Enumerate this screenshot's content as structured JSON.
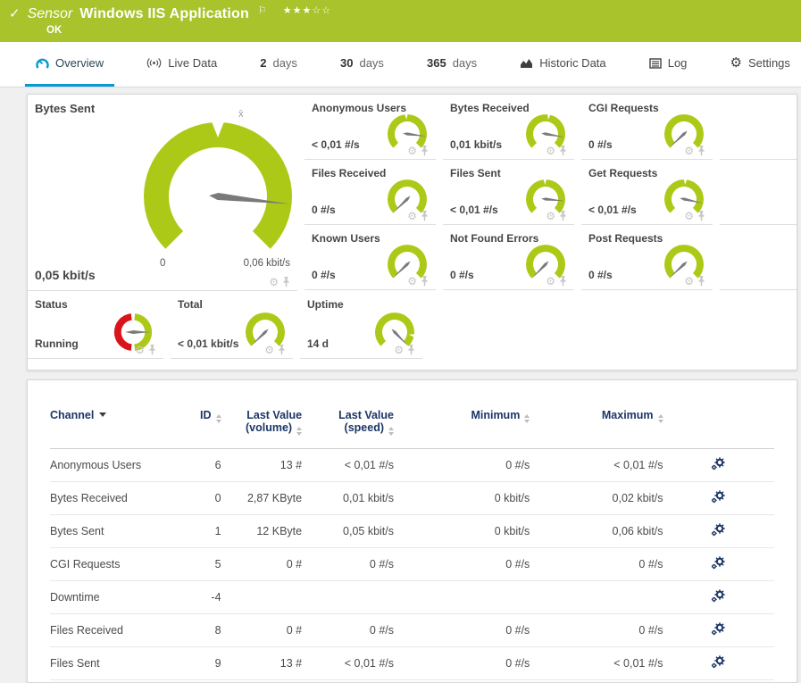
{
  "colors": {
    "header_green": "#a8c32b",
    "gauge_green": "#adc917",
    "status_red": "#d9151b",
    "blue": "#0898d4",
    "navy": "#1b3667",
    "needle_gray": "#7a7a7a"
  },
  "header": {
    "kind_label": "Sensor",
    "title": "Windows IIS Application",
    "status": "OK",
    "stars_filled": 3,
    "stars_total": 5,
    "check_icon": "✓",
    "flag_icon": "⚐"
  },
  "tabs": [
    {
      "id": "overview",
      "icon": "gauge-icon",
      "label": "Overview",
      "active": true
    },
    {
      "id": "live-data",
      "icon": "broadcast-icon",
      "label": "Live Data"
    },
    {
      "id": "2-days",
      "num": "2",
      "label": "days"
    },
    {
      "id": "30-days",
      "num": "30",
      "label": "days"
    },
    {
      "id": "365-days",
      "num": "365",
      "label": "days"
    },
    {
      "id": "historic-data",
      "icon": "chart-icon",
      "label": "Historic Data"
    },
    {
      "id": "log",
      "icon": "log-icon",
      "label": "Log"
    },
    {
      "id": "settings",
      "icon": "gear-icon",
      "label": "Settings"
    }
  ],
  "gauges": {
    "main": {
      "label": "Bytes Sent",
      "value": "0,05 kbit/s",
      "scale_min": "0",
      "scale_max": "0,06 kbit/s",
      "avg_marker": "x̄",
      "needle_deg": 96,
      "notch_deg": 0
    },
    "small": [
      {
        "label": "Anonymous Users",
        "value": "< 0,01 #/s",
        "needle_deg": 97,
        "notch_deg": -3
      },
      {
        "label": "Bytes Received",
        "value": "0,01 kbit/s",
        "needle_deg": 100,
        "notch_deg": 10
      },
      {
        "label": "CGI Requests",
        "value": "0 #/s",
        "needle_deg": 227,
        "notch_deg": null
      },
      {
        "label": "Files Received",
        "value": "0 #/s",
        "needle_deg": 226,
        "notch_deg": null
      },
      {
        "label": "Files Sent",
        "value": "< 0,01 #/s",
        "needle_deg": 96,
        "notch_deg": -2
      },
      {
        "label": "Get Requests",
        "value": "< 0,01 #/s",
        "needle_deg": 102,
        "notch_deg": 4
      },
      {
        "label": "Known Users",
        "value": "0 #/s",
        "needle_deg": 226,
        "notch_deg": null
      },
      {
        "label": "Not Found Errors",
        "value": "0 #/s",
        "needle_deg": 224,
        "notch_deg": null
      },
      {
        "label": "Post Requests",
        "value": "0 #/s",
        "needle_deg": 227,
        "notch_deg": null
      }
    ],
    "bottom": [
      {
        "label": "Status",
        "value": "Running",
        "kind": "ring",
        "needle_deg": 90
      },
      {
        "label": "Total",
        "value": "< 0,01 kbit/s",
        "needle_deg": 226,
        "notch_deg": null
      },
      {
        "label": "Uptime",
        "value": "14 d",
        "needle_deg": 136,
        "notch_deg": 100
      }
    ]
  },
  "table": {
    "headers": [
      {
        "label": "Channel",
        "sort": "down",
        "align": "left"
      },
      {
        "label": "ID",
        "sort": "both",
        "align": "right"
      },
      {
        "lines": [
          "Last Value",
          "(volume)"
        ],
        "sort": "both",
        "align": "right"
      },
      {
        "lines": [
          "Last Value",
          "(speed)"
        ],
        "sort": "both",
        "align": "right"
      },
      {
        "label": "Minimum",
        "sort": "both",
        "align": "right"
      },
      {
        "label": "Maximum",
        "sort": "both",
        "align": "right"
      },
      {
        "label": "",
        "sort": null
      }
    ],
    "rows": [
      {
        "name": "Anonymous Users",
        "id": "6",
        "last_volume": "13 #",
        "last_speed": "< 0,01 #/s",
        "min": "0 #/s",
        "max": "< 0,01 #/s"
      },
      {
        "name": "Bytes Received",
        "id": "0",
        "last_volume": "2,87 KByte",
        "last_speed": "0,01 kbit/s",
        "min": "0 kbit/s",
        "max": "0,02 kbit/s"
      },
      {
        "name": "Bytes Sent",
        "id": "1",
        "last_volume": "12 KByte",
        "last_speed": "0,05 kbit/s",
        "min": "0 kbit/s",
        "max": "0,06 kbit/s"
      },
      {
        "name": "CGI Requests",
        "id": "5",
        "last_volume": "0 #",
        "last_speed": "0 #/s",
        "min": "0 #/s",
        "max": "0 #/s"
      },
      {
        "name": "Downtime",
        "id": "-4",
        "last_volume": "",
        "last_speed": "",
        "min": "",
        "max": ""
      },
      {
        "name": "Files Received",
        "id": "8",
        "last_volume": "0 #",
        "last_speed": "0 #/s",
        "min": "0 #/s",
        "max": "0 #/s"
      },
      {
        "name": "Files Sent",
        "id": "9",
        "last_volume": "13 #",
        "last_speed": "< 0,01 #/s",
        "min": "0 #/s",
        "max": "< 0,01 #/s"
      }
    ]
  }
}
